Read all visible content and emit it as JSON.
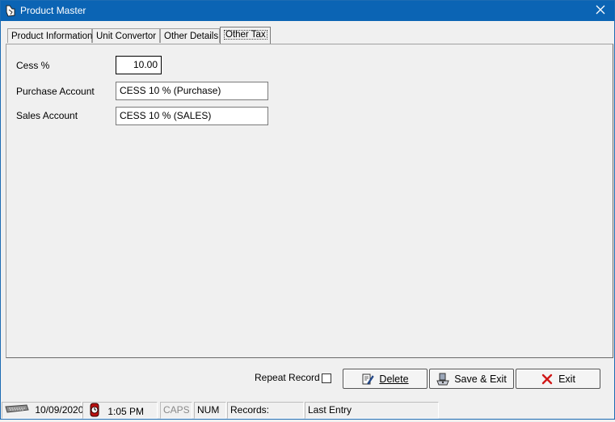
{
  "window": {
    "title": "Product Master"
  },
  "tabs": [
    {
      "label": "Product Information"
    },
    {
      "label": "Unit Convertor"
    },
    {
      "label": "Other Details"
    },
    {
      "label": "Other Tax",
      "active": true
    }
  ],
  "form": {
    "cess_label": "Cess %",
    "cess_value": "10.00",
    "purchase_account_label": "Purchase Account",
    "purchase_account_value": "CESS 10 % (Purchase)",
    "sales_account_label": "Sales Account",
    "sales_account_value": "CESS 10 % (SALES)"
  },
  "footer": {
    "repeat_record_label": "Repeat Record",
    "repeat_record_checked": false,
    "delete_label": "Delete",
    "save_exit_label": "Save & Exit",
    "exit_label": "Exit"
  },
  "statusbar": {
    "date": "10/09/2020",
    "time": "1:05 PM",
    "caps": "CAPS",
    "num": "NUM",
    "records": "Records:",
    "last_entry": "Last Entry"
  },
  "icons": {
    "app": "app-icon",
    "close": "close-icon",
    "delete": "delete-edit-icon",
    "save": "save-icon",
    "exit": "exit-x-icon",
    "date": "keyboard-icon",
    "time": "clock-icon"
  },
  "colors": {
    "titlebar": "#0b64b4",
    "exit_x": "#d01818"
  }
}
